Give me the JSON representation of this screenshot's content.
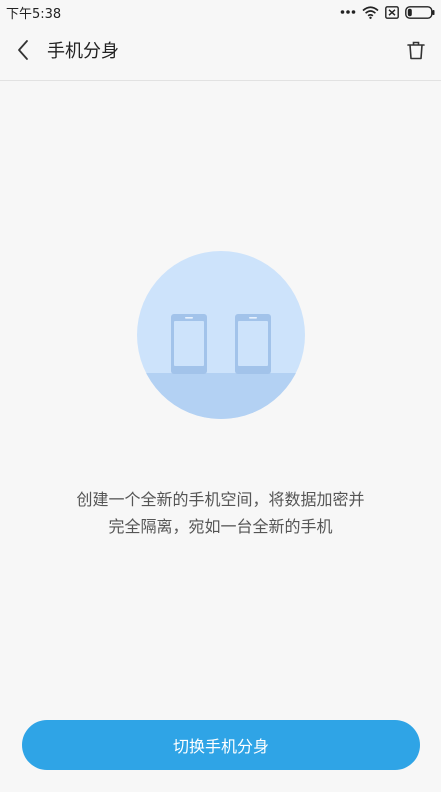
{
  "status_bar": {
    "time": "下午5:38",
    "icons": [
      "more-dots-icon",
      "wifi-icon",
      "no-sim-icon",
      "battery-icon"
    ]
  },
  "header": {
    "back_icon": "chevron-left-icon",
    "title": "手机分身",
    "delete_icon": "trash-icon"
  },
  "illustration": {
    "icon": "two-phones-icon",
    "circle_color": "#cde3fb",
    "floor_color": "#b3d1f3",
    "phone_color": "#a2c3ea"
  },
  "description": {
    "line1": "创建一个全新的手机空间，将数据加密并",
    "line2": "完全隔离，宛如一台全新的手机"
  },
  "footer": {
    "button_label": "切换手机分身",
    "button_color": "#2fa4e6"
  }
}
